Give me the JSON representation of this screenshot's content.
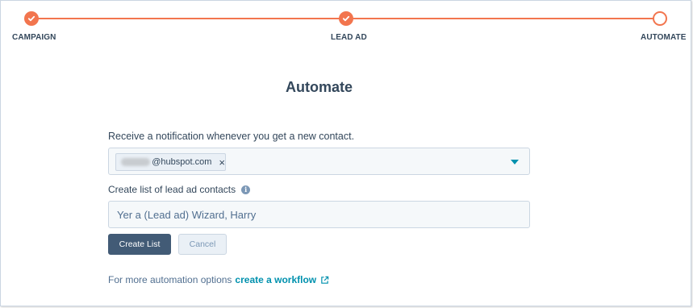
{
  "stepper": {
    "steps": [
      {
        "label": "CAMPAIGN",
        "state": "done"
      },
      {
        "label": "LEAD AD",
        "state": "done"
      },
      {
        "label": "AUTOMATE",
        "state": "current"
      }
    ]
  },
  "page": {
    "title": "Automate"
  },
  "notification": {
    "label": "Receive a notification whenever you get a new contact.",
    "chip_email_suffix": "@hubspot.com",
    "chip_remove_glyph": "×"
  },
  "list": {
    "label": "Create list of lead ad contacts",
    "info_glyph": "i",
    "name_value": "Yer a (Lead ad) Wizard, Harry"
  },
  "buttons": {
    "create_list": "Create List",
    "cancel": "Cancel"
  },
  "footer": {
    "prefix": "For more automation options",
    "link": "create a workflow"
  },
  "colors": {
    "accent": "#f2754e",
    "link": "#0091ae",
    "primary_button": "#425b76",
    "text": "#33475b"
  }
}
